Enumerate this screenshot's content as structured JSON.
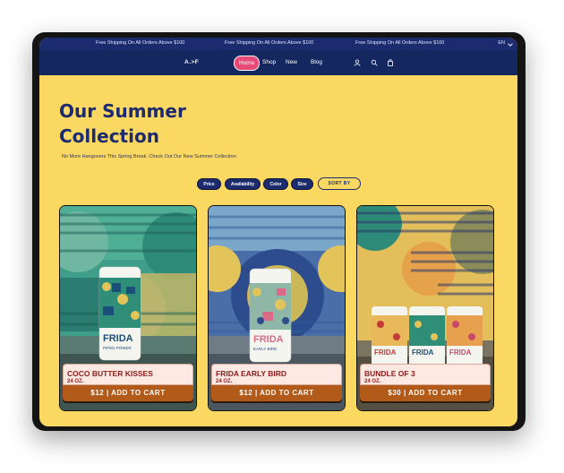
{
  "announcement": {
    "messages": [
      "Free Shipping On All Orders Above $100",
      "Free Shipping On All Orders Above $100",
      "Free Shipping On All Orders Above $100"
    ],
    "language": "EN"
  },
  "nav": {
    "logo": "A.>F",
    "links": [
      "Home",
      "Shop",
      "New",
      "Blog"
    ],
    "active": "Home",
    "icons": [
      "user-icon",
      "search-icon",
      "cart-icon"
    ]
  },
  "hero": {
    "title": "Our Summer Collection",
    "subtitle": "No More Hangovers This Spring Break. Check Out Our New Summer Collection."
  },
  "filters": [
    "Price",
    "Availability",
    "Color",
    "Size"
  ],
  "sort_label": "SORT BY",
  "products": [
    {
      "name": "COCO BUTTER KISSES",
      "size": "24 OZ.",
      "cart_label": "$12 | ADD TO CART",
      "can_brand": "FRIDA",
      "can_sub": "PIPED POWER"
    },
    {
      "name": "FRIDA EARLY BIRD",
      "size": "24 OZ.",
      "cart_label": "$12 | ADD TO CART",
      "can_brand": "FRIDA",
      "can_sub": "EARLY BIRD"
    },
    {
      "name": "BUNDLE OF 3",
      "size": "24 OZ.",
      "cart_label": "$30 | ADD TO CART",
      "can_brand": "FRIDA",
      "can_sub": ""
    }
  ],
  "colors": {
    "background": "#FBD862",
    "navy": "#1B2B6E",
    "accent": "#E64A77",
    "cart": "#B15A1A",
    "product_name": "#8E1B1B"
  }
}
